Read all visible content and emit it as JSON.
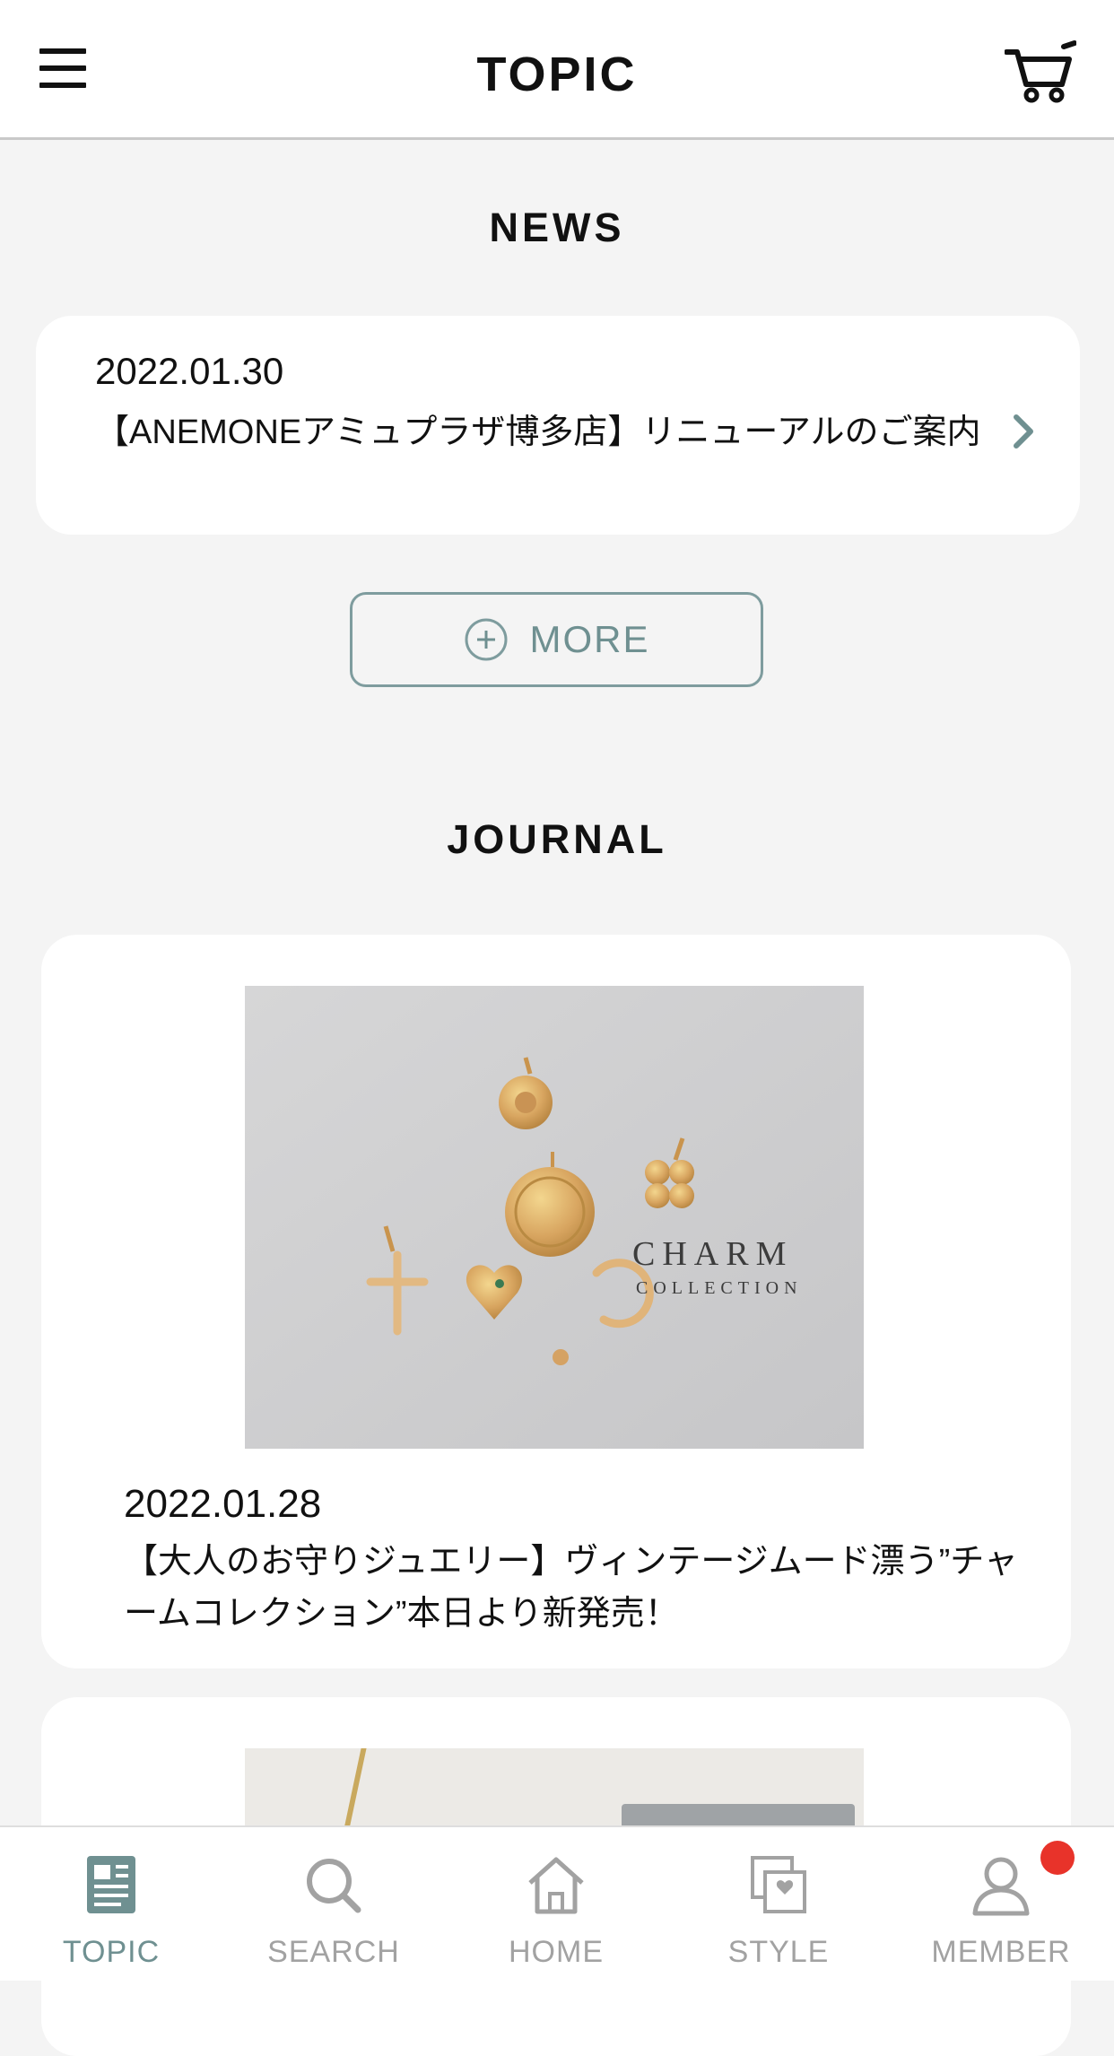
{
  "header": {
    "title": "TOPIC",
    "menu_icon": "hamburger-menu-icon",
    "cart_icon": "cart-icon"
  },
  "news": {
    "section_title": "NEWS",
    "items": [
      {
        "date": "2022.01.30",
        "title": "【ANEMONEアミュプラザ博多店】リニューアルのご案内"
      }
    ],
    "more_label": "MORE"
  },
  "journal": {
    "section_title": "JOURNAL",
    "items": [
      {
        "image_text_main": "CHARM",
        "image_text_sub": "COLLECTION",
        "date": "2022.01.28",
        "title": "【大人のお守りジュエリー】ヴィンテージムード漂う”チャームコレクション”本日より新発売！"
      }
    ]
  },
  "tabbar": {
    "tabs": [
      {
        "label": "TOPIC",
        "icon": "topic-newspaper-icon",
        "active": true
      },
      {
        "label": "SEARCH",
        "icon": "search-icon",
        "active": false
      },
      {
        "label": "HOME",
        "icon": "home-icon",
        "active": false
      },
      {
        "label": "STYLE",
        "icon": "style-photos-icon",
        "active": false
      },
      {
        "label": "MEMBER",
        "icon": "member-person-icon",
        "active": false
      }
    ]
  },
  "colors": {
    "accent": "#6f9091",
    "badge": "#e8332a",
    "inactive": "#a2a2a2"
  }
}
